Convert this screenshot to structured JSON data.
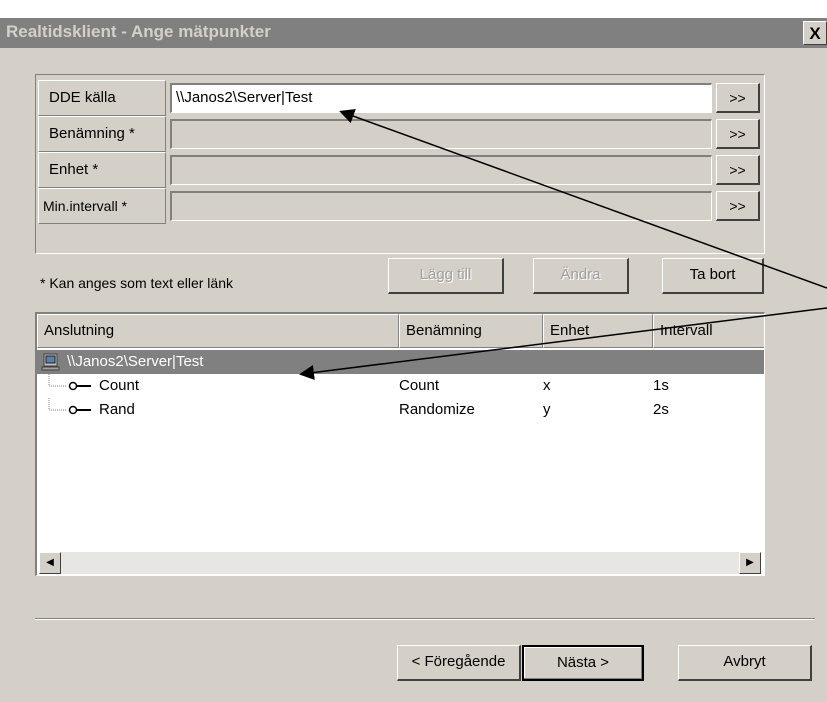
{
  "window": {
    "title": "Realtidsklient - Ange mätpunkter",
    "close_glyph": "X"
  },
  "form": {
    "rows": [
      {
        "label": "DDE källa",
        "value": "\\\\Janos2\\Server|Test",
        "button": ">>"
      },
      {
        "label": "Benämning *",
        "value": "",
        "button": ">>"
      },
      {
        "label": "Enhet *",
        "value": "",
        "button": ">>"
      },
      {
        "label": "Min.intervall *",
        "value": "",
        "button": ">>"
      }
    ],
    "note": "* Kan anges som text eller länk"
  },
  "actions": {
    "add": "Lägg till",
    "change": "Ändra",
    "remove": "Ta bort"
  },
  "list": {
    "columns": [
      "Anslutning",
      "Benämning",
      "Enhet",
      "Intervall"
    ],
    "rows": [
      {
        "connection": "\\\\Janos2\\Server|Test",
        "name": "",
        "unit": "",
        "interval": "",
        "selected": true
      },
      {
        "connection": "Count",
        "name": "Count",
        "unit": "x",
        "interval": "1s"
      },
      {
        "connection": "Rand",
        "name": "Randomize",
        "unit": "y",
        "interval": "2s"
      }
    ]
  },
  "footer": {
    "back": "Föregående",
    "next": "Nästa",
    "cancel": "Avbryt"
  }
}
